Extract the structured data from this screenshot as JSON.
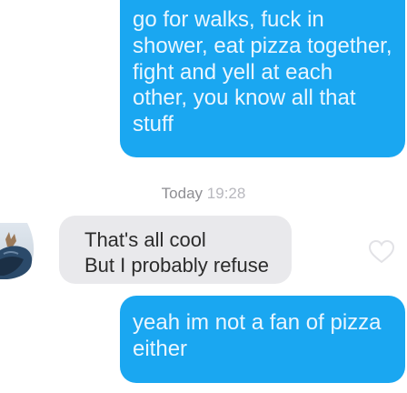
{
  "messages": {
    "sent_top": "go for walks, fuck in shower, eat pizza together, fight and yell at each other, you know all that stuff",
    "timestamp_day": "Today",
    "timestamp_time": "19:28",
    "received_line1": "That's all cool",
    "received_line2": "But I probably refuse",
    "sent_bottom": "yeah im not a fan of pizza either"
  },
  "icons": {
    "like": "heart-outline-icon",
    "avatar": "profile-photo"
  },
  "colors": {
    "sent_bubble": "#1aa7f1",
    "received_bubble": "#e9e9ec",
    "timestamp": "#8e8e93",
    "heart_outline": "#e2e2e6"
  }
}
